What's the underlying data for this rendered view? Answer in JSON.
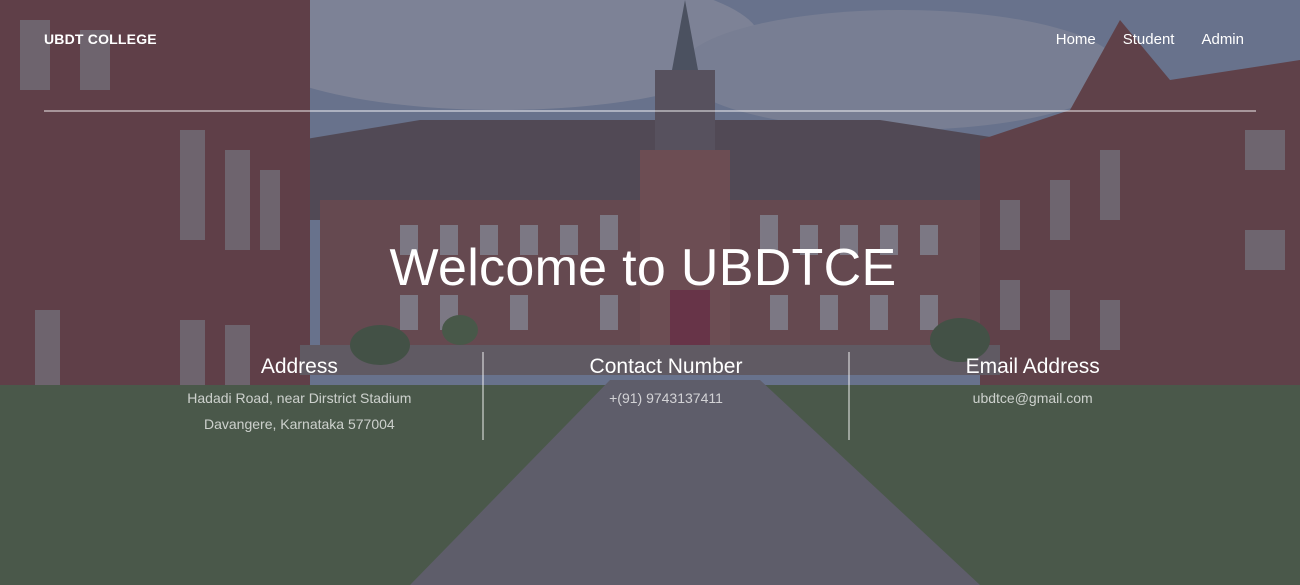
{
  "navbar": {
    "brand": "UBDT COLLEGE",
    "links": [
      {
        "label": "Home"
      },
      {
        "label": "Student"
      },
      {
        "label": "Admin"
      }
    ]
  },
  "hero": {
    "title": "Welcome to UBDTCE"
  },
  "info": {
    "address": {
      "heading": "Address",
      "line1": "Hadadi Road, near Dirstrict Stadium",
      "line2": "Davangere, Karnataka 577004"
    },
    "contact": {
      "heading": "Contact Number",
      "value": "+(91) 9743137411"
    },
    "email": {
      "heading": "Email Address",
      "value": "ubdtce@gmail.com"
    }
  },
  "colors": {
    "overlay": "#3a3c58",
    "text": "#ffffff",
    "brick": "#8a4a3c",
    "grass": "#5e7a3a"
  }
}
